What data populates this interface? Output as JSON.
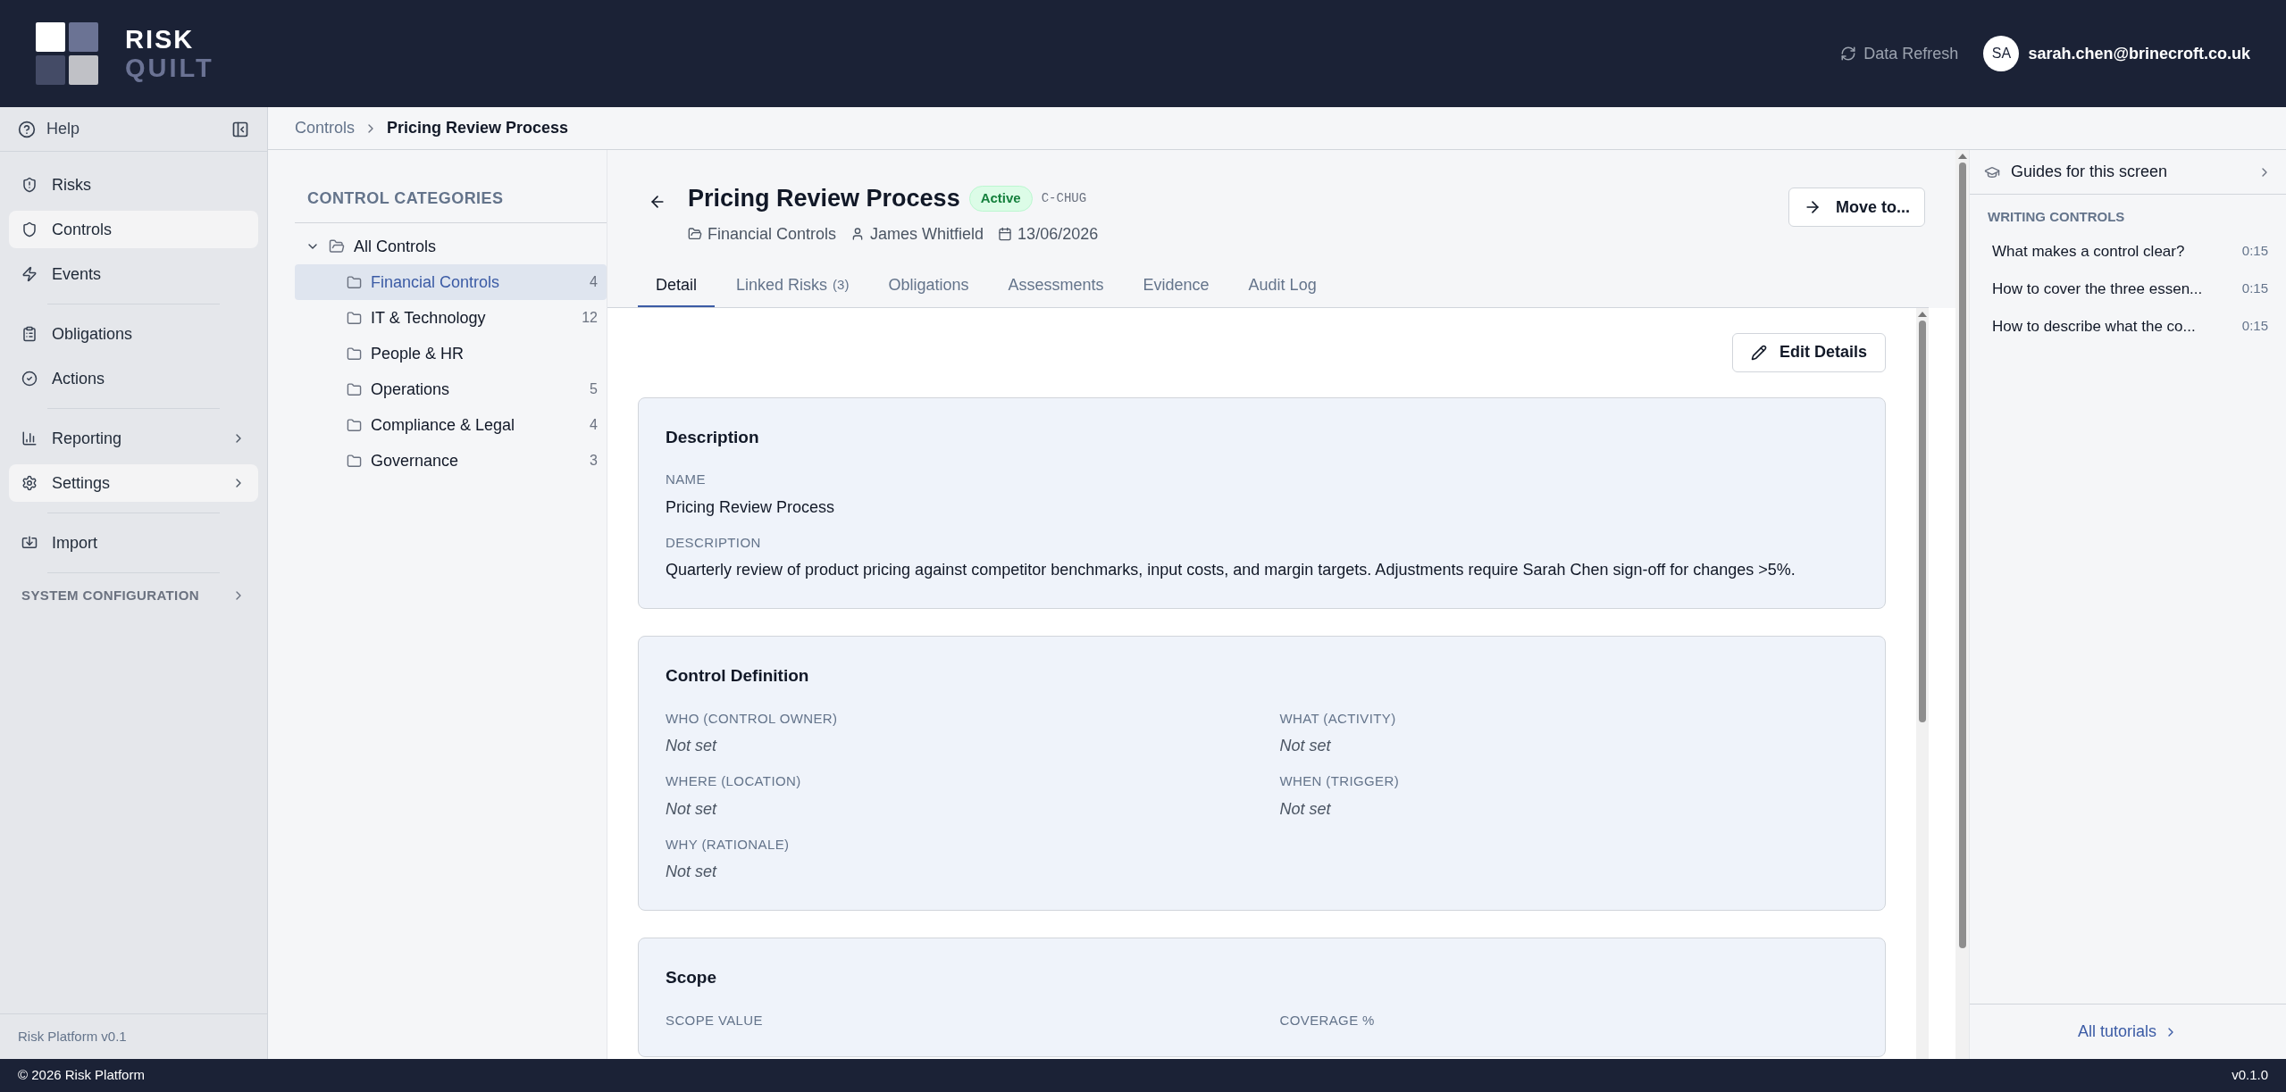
{
  "header": {
    "logo": {
      "line1": "RISK",
      "line2": "QUILT"
    },
    "refresh": "Data Refresh",
    "user": {
      "initials": "SA",
      "email": "sarah.chen@brinecroft.co.uk"
    }
  },
  "sidebar": {
    "help": "Help",
    "groups": [
      [
        {
          "label": "Risks",
          "highlighted": false,
          "expandable": false
        },
        {
          "label": "Controls",
          "highlighted": true,
          "expandable": false
        },
        {
          "label": "Events",
          "highlighted": false,
          "expandable": false
        }
      ],
      [
        {
          "label": "Obligations",
          "highlighted": false,
          "expandable": false
        },
        {
          "label": "Actions",
          "highlighted": false,
          "expandable": false
        }
      ],
      [
        {
          "label": "Reporting",
          "highlighted": false,
          "expandable": true
        },
        {
          "label": "Settings",
          "highlighted": true,
          "expandable": true
        }
      ],
      [
        {
          "label": "Import",
          "highlighted": false,
          "expandable": false
        }
      ]
    ],
    "section": "SYSTEM CONFIGURATION",
    "version": "Risk Platform v0.1"
  },
  "breadcrumb": [
    "Controls",
    "Pricing Review Process"
  ],
  "categories": {
    "title": "CONTROL CATEGORIES",
    "tree": [
      {
        "label": "All Controls",
        "expanded": true,
        "selected": false,
        "children": [
          {
            "label": "Financial Controls",
            "count": "4",
            "selected": true
          },
          {
            "label": "IT & Technology",
            "count": "12",
            "selected": false
          },
          {
            "label": "People & HR",
            "selected": false
          },
          {
            "label": "Operations",
            "count": "5",
            "selected": false
          },
          {
            "label": "Compliance & Legal",
            "count": "4",
            "selected": false
          },
          {
            "label": "Governance",
            "count": "3",
            "selected": false
          }
        ]
      }
    ]
  },
  "control": {
    "title": "Pricing Review Process",
    "status": "Active",
    "code": "C-CHUG",
    "category": "Financial Controls",
    "owner": "James Whitfield",
    "date": "13/06/2026",
    "move_button": "Move to...",
    "tabs": [
      {
        "label": "Detail",
        "selected": true
      },
      {
        "label": "Linked Risks",
        "count": "(3)",
        "selected": false
      },
      {
        "label": "Obligations",
        "selected": false
      },
      {
        "label": "Assessments",
        "selected": false
      },
      {
        "label": "Evidence",
        "selected": false
      },
      {
        "label": "Audit Log",
        "selected": false
      }
    ],
    "edit_button": "Edit Details",
    "sections": [
      {
        "title": "Description",
        "kind": "stack",
        "fields": [
          {
            "label": "NAME",
            "value": "Pricing Review Process",
            "set": true
          },
          {
            "label": "DESCRIPTION",
            "value": "Quarterly review of product pricing against competitor benchmarks, input costs, and margin targets. Adjustments require Sarah Chen sign-off for changes >5%.",
            "set": true
          }
        ]
      },
      {
        "title": "Control Definition",
        "kind": "grid",
        "fields": [
          {
            "label": "WHO (CONTROL OWNER)",
            "value": "Not set",
            "set": false
          },
          {
            "label": "WHAT (ACTIVITY)",
            "value": "Not set",
            "set": false
          },
          {
            "label": "WHERE (LOCATION)",
            "value": "Not set",
            "set": false
          },
          {
            "label": "WHEN (TRIGGER)",
            "value": "Not set",
            "set": false
          },
          {
            "label": "WHY (RATIONALE)",
            "value": "Not set",
            "set": false
          }
        ]
      },
      {
        "title": "Scope",
        "kind": "grid",
        "fields": [
          {
            "label": "SCOPE VALUE"
          },
          {
            "label": "COVERAGE %"
          }
        ]
      }
    ]
  },
  "guides": {
    "title": "Guides for this screen",
    "section": "WRITING CONTROLS",
    "items": [
      {
        "label": "What makes a control clear?",
        "duration": "0:15"
      },
      {
        "label": "How to cover the three essen...",
        "duration": "0:15"
      },
      {
        "label": "How to describe what the co...",
        "duration": "0:15"
      }
    ],
    "all_link": "All tutorials"
  },
  "footer": {
    "copyright": "© 2026 Risk Platform",
    "version": "v0.1.0"
  }
}
